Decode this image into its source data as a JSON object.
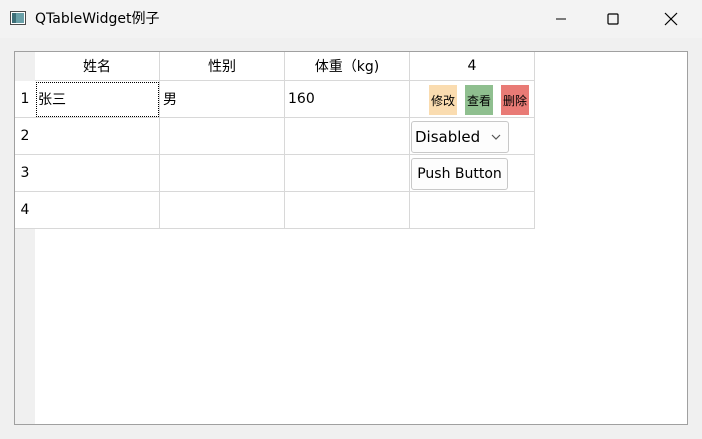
{
  "window": {
    "title": "QTableWidget例子",
    "icon": "app-window-icon",
    "controls": [
      "minimize-icon",
      "maximize-icon",
      "close-icon"
    ]
  },
  "table": {
    "column_headers": [
      "姓名",
      "性别",
      "体重（kg)",
      "4"
    ],
    "row_headers": [
      "1",
      "2",
      "3",
      "4"
    ],
    "rows": [
      [
        "张三",
        "男",
        "160",
        ""
      ],
      [
        "",
        "",
        "",
        ""
      ],
      [
        "",
        "",
        "",
        ""
      ],
      [
        "",
        "",
        "",
        ""
      ]
    ],
    "action_buttons": {
      "edit": "修改",
      "view": "查看",
      "delete": "删除"
    },
    "combo_box": {
      "selected": "Disabled"
    },
    "push_button": {
      "label": "Push Button"
    }
  },
  "colors": {
    "edit_button": "#fadcb0",
    "view_button": "#8fbf8f",
    "delete_button": "#e97b76",
    "grid_line": "#d8d8d8"
  }
}
